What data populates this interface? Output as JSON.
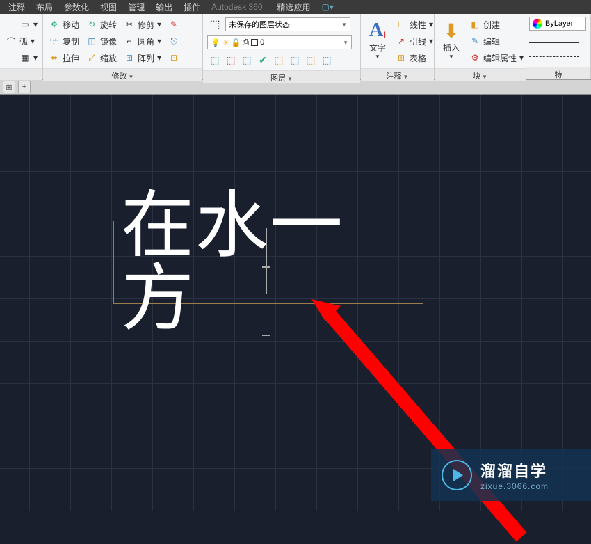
{
  "menu": {
    "items": [
      "注释",
      "布局",
      "参数化",
      "视图",
      "管理",
      "输出",
      "插件"
    ],
    "autodesk": "Autodesk 360",
    "featured": "精选应用"
  },
  "ribbon": {
    "modify": {
      "title": "修改",
      "move": "移动",
      "copy": "复制",
      "stretch": "拉伸",
      "rotate": "旋转",
      "mirror": "镜像",
      "scale": "缩放",
      "trim": "修剪",
      "fillet": "圆角",
      "array": "阵列"
    },
    "layer": {
      "title": "图层",
      "dropdown": "未保存的图层状态",
      "layer0": "0"
    },
    "annotate": {
      "title": "注释",
      "text": "文字",
      "linear": "线性",
      "leader": "引线",
      "table": "表格"
    },
    "block": {
      "title": "块",
      "insert": "插入",
      "create": "创建",
      "edit": "编辑",
      "editattr": "编辑属性"
    },
    "properties": {
      "title": "特",
      "bylayer": "ByLayer"
    },
    "draw": {
      "arc": "弧"
    }
  },
  "canvas": {
    "text": "在水一方"
  },
  "watermark": {
    "title": "溜溜自学",
    "url": "zixue.3066.com"
  }
}
